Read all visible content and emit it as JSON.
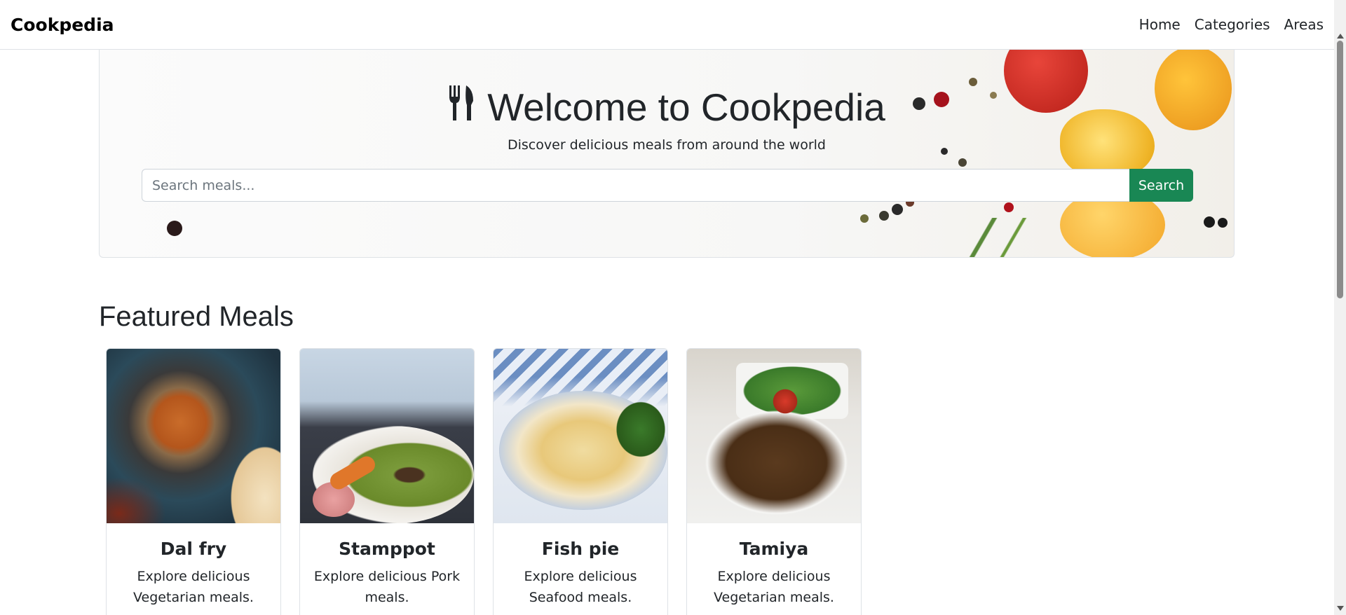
{
  "navbar": {
    "brand": "Cookpedia",
    "links": [
      "Home",
      "Categories",
      "Areas"
    ]
  },
  "hero": {
    "icon": "utensils-icon",
    "title": "Welcome to Cookpedia",
    "subtitle": "Discover delicious meals from around the world",
    "search_placeholder": "Search meals...",
    "search_button": "Search"
  },
  "featured": {
    "heading": "Featured Meals",
    "meals": [
      {
        "name": "Dal fry",
        "description": "Explore delicious Vegetarian meals.",
        "image": "dal-fry-photo"
      },
      {
        "name": "Stamppot",
        "description": "Explore delicious Pork meals.",
        "image": "stamppot-photo"
      },
      {
        "name": "Fish pie",
        "description": "Explore delicious Seafood meals.",
        "image": "fish-pie-photo"
      },
      {
        "name": "Tamiya",
        "description": "Explore delicious Vegetarian meals.",
        "image": "tamiya-photo"
      }
    ]
  },
  "colors": {
    "accent": "#198754",
    "text": "#212529",
    "border": "#dee2e6"
  }
}
